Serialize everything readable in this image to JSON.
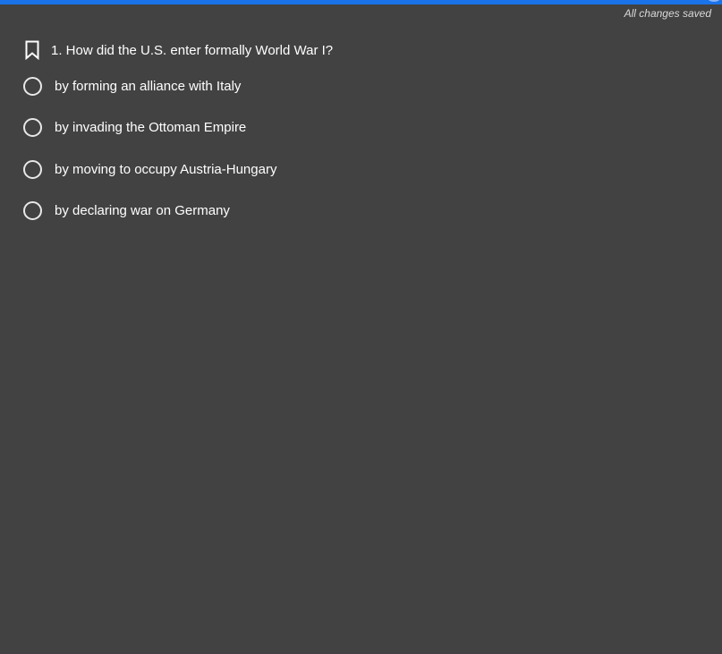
{
  "header": {
    "save_status": "All changes saved"
  },
  "question": {
    "text": "1. How did the U.S. enter formally World War I?",
    "bookmark_icon": "bookmark-icon"
  },
  "options": [
    {
      "label": "by forming an alliance with Italy",
      "selected": false
    },
    {
      "label": "by invading the Ottoman Empire",
      "selected": false
    },
    {
      "label": "by moving to occupy Austria-Hungary",
      "selected": false
    },
    {
      "label": "by declaring war on Germany",
      "selected": false
    }
  ],
  "colors": {
    "background": "#424242",
    "top_bar": "#1a73e8",
    "text": "#ffffff",
    "status_text": "#d9d9d9"
  }
}
